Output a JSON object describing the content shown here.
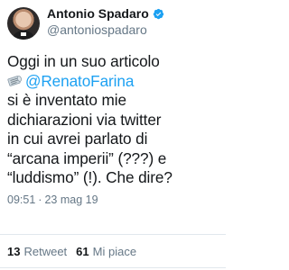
{
  "user": {
    "display_name": "Antonio Spadaro",
    "handle": "@antoniospadaro",
    "verified_color": "#1da1f2"
  },
  "tweet": {
    "line1": "Oggi in un suo articolo",
    "news_icon": "rolled-up-newspaper-icon",
    "mention": "@RenatoFarina",
    "line3": "si è inventato mie",
    "line4": "dichiarazioni via twitter",
    "line5": "in cui avrei parlato di",
    "line6": "“arcana imperii” (???) e",
    "line7": "“luddismo” (!). Che dire?",
    "time": "09:51",
    "separator": "·",
    "date": "23 mag 19"
  },
  "stats": {
    "retweets_count": "13",
    "retweets_label": "Retweet",
    "likes_count": "61",
    "likes_label": "Mi piace"
  },
  "colors": {
    "link": "#1da1f2",
    "secondary_text": "#657786",
    "divider": "#e1e8ed"
  }
}
